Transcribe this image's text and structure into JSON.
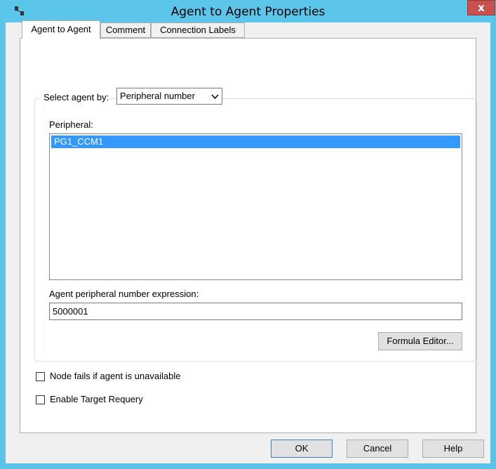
{
  "window": {
    "title": "Agent to Agent Properties",
    "close_glyph": "x",
    "icon": "agent-node-icon"
  },
  "tabs": [
    {
      "label": "Agent to Agent",
      "active": true
    },
    {
      "label": "Comment",
      "active": false
    },
    {
      "label": "Connection Labels",
      "active": false
    }
  ],
  "select_agent": {
    "label": "Select agent by:",
    "value": "Peripheral number"
  },
  "peripheral": {
    "label": "Peripheral:",
    "items": [
      "PG1_CCM1"
    ],
    "selected_index": 0
  },
  "expression": {
    "label": "Agent peripheral number expression:",
    "value": "5000001"
  },
  "formula_editor_label": "Formula Editor...",
  "options": {
    "node_fails": {
      "label": "Node fails if agent is unavailable",
      "checked": false
    },
    "target_requery": {
      "label": "Enable Target Requery",
      "checked": false
    }
  },
  "footer": {
    "ok": "OK",
    "cancel": "Cancel",
    "help": "Help"
  },
  "colors": {
    "titlebar": "#5cc6ea",
    "close": "#c75050",
    "selection": "#3399ff"
  }
}
